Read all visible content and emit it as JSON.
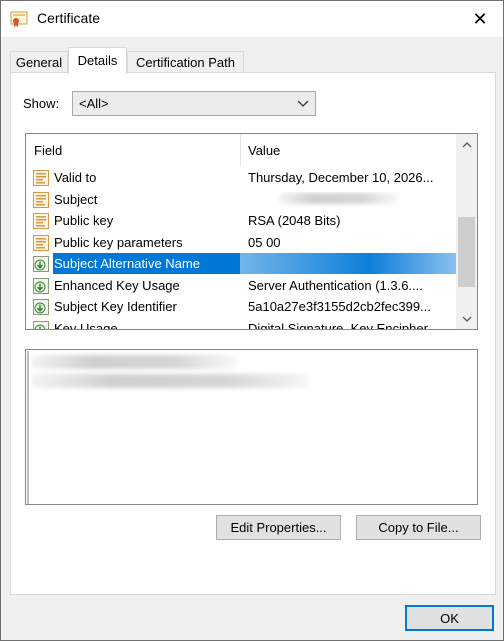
{
  "window": {
    "title": "Certificate",
    "close_glyph": "✕"
  },
  "tabs": [
    {
      "label": "General"
    },
    {
      "label": "Details"
    },
    {
      "label": "Certification Path"
    }
  ],
  "show": {
    "label": "Show:",
    "selected": "<All>"
  },
  "list": {
    "header_field": "Field",
    "header_value": "Value",
    "rows": [
      {
        "field": "Valid to",
        "value": "Thursday, December 10, 2026...",
        "icon": "certificate-field-icon"
      },
      {
        "field": "Subject",
        "value": "",
        "icon": "certificate-field-icon"
      },
      {
        "field": "Public key",
        "value": "RSA (2048 Bits)",
        "icon": "certificate-field-icon"
      },
      {
        "field": "Public key parameters",
        "value": "05 00",
        "icon": "certificate-field-icon"
      },
      {
        "field": "Subject Alternative Name",
        "value": "",
        "icon": "extension-icon"
      },
      {
        "field": "Enhanced Key Usage",
        "value": "Server Authentication (1.3.6....",
        "icon": "extension-icon"
      },
      {
        "field": "Subject Key Identifier",
        "value": "5a10a27e3f3155d2cb2fec399...",
        "icon": "extension-icon"
      },
      {
        "field": "Key Usage",
        "value": "Digital Signature, Key Encipher...",
        "icon": "extension-icon"
      }
    ],
    "selected_index": 4
  },
  "buttons": {
    "edit_properties": "Edit Properties...",
    "copy_to_file": "Copy to File...",
    "ok": "OK"
  },
  "colors": {
    "selection": "#0078d7",
    "accent": "#0078d7"
  }
}
